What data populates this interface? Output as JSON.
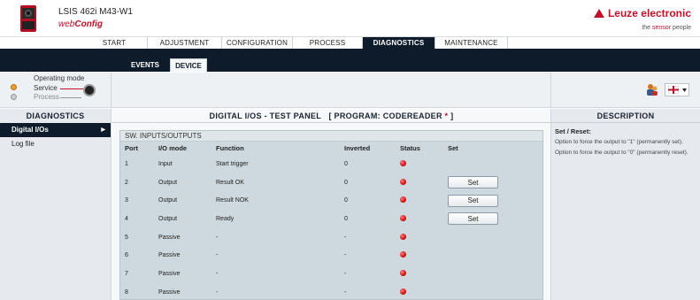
{
  "header": {
    "device_title": "LSIS 462i M43-W1",
    "app_name_web": "web",
    "app_name_config": "Config",
    "brand": "Leuze electronic",
    "tagline_prefix": "the ",
    "tagline_accent": "sensor",
    "tagline_suffix": " people",
    "brand_color": "#c0102a"
  },
  "main_nav": {
    "tabs": [
      {
        "label": "START"
      },
      {
        "label": "ADJUSTMENT"
      },
      {
        "label": "CONFIGURATION"
      },
      {
        "label": "PROCESS"
      },
      {
        "label": "DIAGNOSTICS",
        "active": true
      },
      {
        "label": "MAINTENANCE"
      }
    ]
  },
  "sub_nav": {
    "tabs": [
      {
        "label": "EVENTS"
      },
      {
        "label": "DEVICE",
        "active": true
      }
    ]
  },
  "operating_mode": {
    "label": "Operating mode",
    "options": [
      "Service",
      "Process"
    ],
    "selected": "Service"
  },
  "left_panel": {
    "title": "DIAGNOSTICS",
    "items": [
      {
        "label": "Digital I/Os",
        "active": true
      },
      {
        "label": "Log file"
      }
    ]
  },
  "center": {
    "title": "DIGITAL I/OS - TEST PANEL",
    "program_label": "[ PROGRAM: CODEREADER",
    "program_star": " *",
    "program_close": " ]",
    "section_title": "SW. INPUTS/OUTPUTS",
    "columns": [
      "Port",
      "I/O mode",
      "Function",
      "Inverted",
      "Status",
      "Set"
    ],
    "rows": [
      {
        "port": "1",
        "mode": "Input",
        "function": "Start trigger",
        "inverted": "0",
        "set": ""
      },
      {
        "port": "2",
        "mode": "Output",
        "function": "Result OK",
        "inverted": "0",
        "set": "Set"
      },
      {
        "port": "3",
        "mode": "Output",
        "function": "Result NOK",
        "inverted": "0",
        "set": "Set"
      },
      {
        "port": "4",
        "mode": "Output",
        "function": "Ready",
        "inverted": "0",
        "set": "Set"
      },
      {
        "port": "5",
        "mode": "Passive",
        "function": "-",
        "inverted": "-",
        "set": ""
      },
      {
        "port": "6",
        "mode": "Passive",
        "function": "-",
        "inverted": "-",
        "set": ""
      },
      {
        "port": "7",
        "mode": "Passive",
        "function": "-",
        "inverted": "-",
        "set": ""
      },
      {
        "port": "8",
        "mode": "Passive",
        "function": "-",
        "inverted": "-",
        "set": ""
      }
    ],
    "status_color": "#d01010"
  },
  "right_panel": {
    "title": "DESCRIPTION",
    "subtitle": "Set / Reset:",
    "lines": [
      "Option to force the output to \"1\" (permanently set).",
      "Option to force the output to \"0\" (permanently reset)."
    ]
  }
}
